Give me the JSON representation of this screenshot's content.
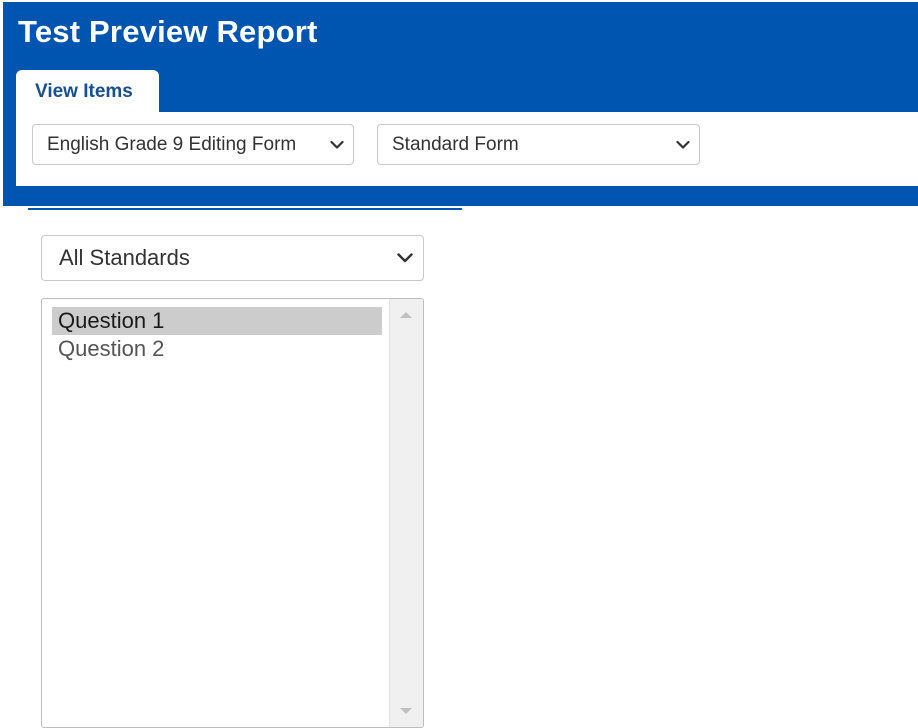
{
  "header": {
    "title": "Test Preview Report"
  },
  "tabs": [
    {
      "label": "View Items",
      "active": true
    }
  ],
  "toolbar": {
    "form_select": {
      "value": "English Grade 9 Editing Form"
    },
    "form_type_select": {
      "value": "Standard Form"
    }
  },
  "standards_select": {
    "value": "All Standards"
  },
  "question_list": {
    "items": [
      {
        "label": "Question 1",
        "selected": true
      },
      {
        "label": "Question 2",
        "selected": false
      }
    ]
  },
  "colors": {
    "header_blue": "#0055b0",
    "tab_text": "#1a4f8f",
    "selected_row": "#cccccc"
  },
  "icons": {
    "select_caret": "chevron-down-icon",
    "scroll_up": "scroll-up-arrow-icon",
    "scroll_down": "scroll-down-arrow-icon"
  }
}
